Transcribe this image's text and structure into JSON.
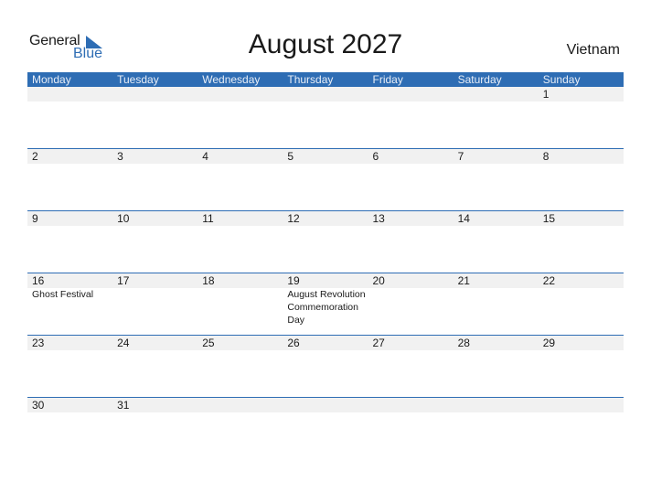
{
  "logo": {
    "word1": "General",
    "word2": "Blue"
  },
  "title": "August 2027",
  "country": "Vietnam",
  "colors": {
    "accent": "#2e6db4",
    "band": "#f1f1f1"
  },
  "days": [
    "Monday",
    "Tuesday",
    "Wednesday",
    "Thursday",
    "Friday",
    "Saturday",
    "Sunday"
  ],
  "weeks": [
    {
      "days": [
        {
          "n": "",
          "e": ""
        },
        {
          "n": "",
          "e": ""
        },
        {
          "n": "",
          "e": ""
        },
        {
          "n": "",
          "e": ""
        },
        {
          "n": "",
          "e": ""
        },
        {
          "n": "",
          "e": ""
        },
        {
          "n": "1",
          "e": ""
        }
      ]
    },
    {
      "days": [
        {
          "n": "2",
          "e": ""
        },
        {
          "n": "3",
          "e": ""
        },
        {
          "n": "4",
          "e": ""
        },
        {
          "n": "5",
          "e": ""
        },
        {
          "n": "6",
          "e": ""
        },
        {
          "n": "7",
          "e": ""
        },
        {
          "n": "8",
          "e": ""
        }
      ]
    },
    {
      "days": [
        {
          "n": "9",
          "e": ""
        },
        {
          "n": "10",
          "e": ""
        },
        {
          "n": "11",
          "e": ""
        },
        {
          "n": "12",
          "e": ""
        },
        {
          "n": "13",
          "e": ""
        },
        {
          "n": "14",
          "e": ""
        },
        {
          "n": "15",
          "e": ""
        }
      ]
    },
    {
      "days": [
        {
          "n": "16",
          "e": "Ghost Festival"
        },
        {
          "n": "17",
          "e": ""
        },
        {
          "n": "18",
          "e": ""
        },
        {
          "n": "19",
          "e": "August Revolution Commemoration Day"
        },
        {
          "n": "20",
          "e": ""
        },
        {
          "n": "21",
          "e": ""
        },
        {
          "n": "22",
          "e": ""
        }
      ]
    },
    {
      "days": [
        {
          "n": "23",
          "e": ""
        },
        {
          "n": "24",
          "e": ""
        },
        {
          "n": "25",
          "e": ""
        },
        {
          "n": "26",
          "e": ""
        },
        {
          "n": "27",
          "e": ""
        },
        {
          "n": "28",
          "e": ""
        },
        {
          "n": "29",
          "e": ""
        }
      ]
    },
    {
      "days": [
        {
          "n": "30",
          "e": ""
        },
        {
          "n": "31",
          "e": ""
        },
        {
          "n": "",
          "e": ""
        },
        {
          "n": "",
          "e": ""
        },
        {
          "n": "",
          "e": ""
        },
        {
          "n": "",
          "e": ""
        },
        {
          "n": "",
          "e": ""
        }
      ]
    }
  ]
}
